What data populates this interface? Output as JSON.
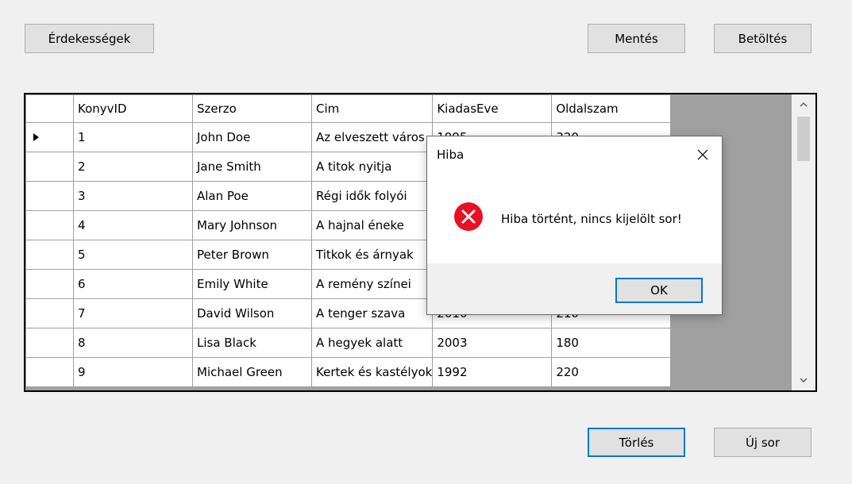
{
  "toolbar": {
    "interests_label": "Érdekességek",
    "save_label": "Mentés",
    "load_label": "Betöltés"
  },
  "bottom": {
    "delete_label": "Törlés",
    "new_row_label": "Új sor"
  },
  "grid": {
    "columns": [
      "KonyvID",
      "Szerzo",
      "Cim",
      "KiadasEve",
      "Oldalszam"
    ],
    "current_row_index": 0,
    "rows": [
      [
        "1",
        "John Doe",
        "Az elveszett város",
        "1995",
        "320"
      ],
      [
        "2",
        "Jane Smith",
        "A titok nyitja",
        "",
        ""
      ],
      [
        "3",
        "Alan Poe",
        "Régi idők folyói",
        "",
        ""
      ],
      [
        "4",
        "Mary Johnson",
        "A hajnal éneke",
        "",
        ""
      ],
      [
        "5",
        "Peter Brown",
        "Titkok és árnyak",
        "",
        ""
      ],
      [
        "6",
        "Emily White",
        "A remény színei",
        "",
        ""
      ],
      [
        "7",
        "David Wilson",
        "A tenger szava",
        "2010",
        "210"
      ],
      [
        "8",
        "Lisa Black",
        "A hegyek alatt",
        "2003",
        "180"
      ],
      [
        "9",
        "Michael Green",
        "Kertek és kastélyok",
        "1992",
        "220"
      ]
    ]
  },
  "dialog": {
    "title": "Hiba",
    "message": "Hiba történt, nincs kijelölt sor!",
    "ok_label": "OK",
    "icon": "error-icon"
  },
  "colors": {
    "error_red": "#e81123",
    "focus_blue": "#0078d7",
    "grid_background": "#a0a0a0"
  }
}
